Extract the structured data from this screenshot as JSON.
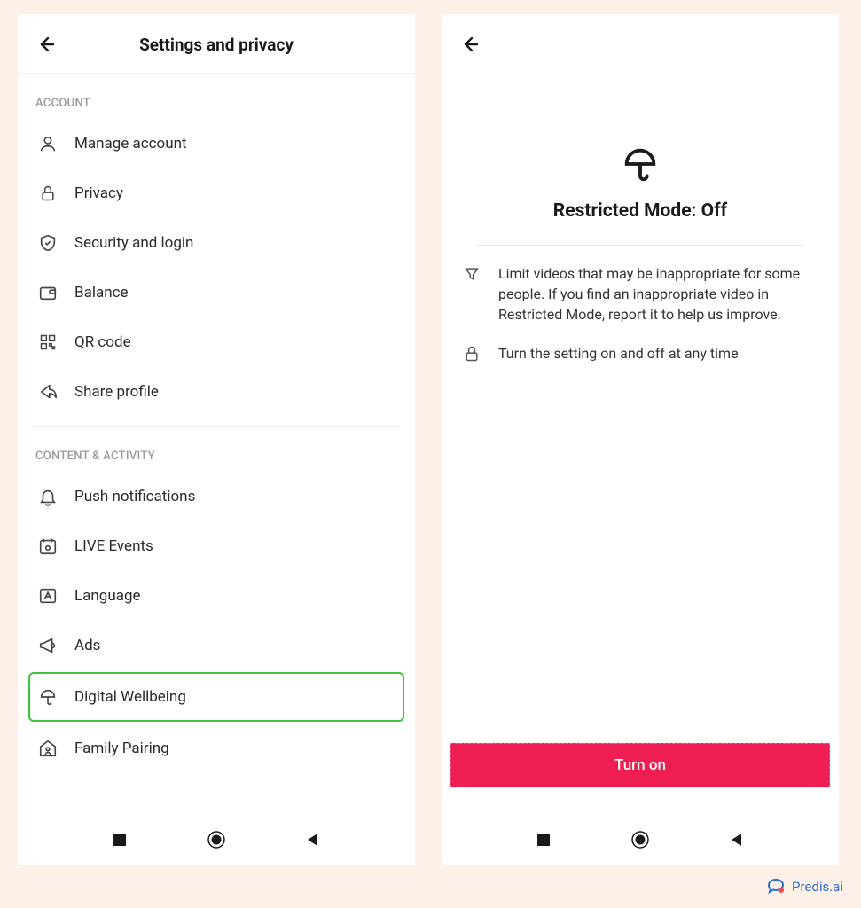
{
  "left": {
    "header_title": "Settings and privacy",
    "sections": [
      {
        "label": "ACCOUNT",
        "items": [
          {
            "icon": "person",
            "label": "Manage account"
          },
          {
            "icon": "lock",
            "label": "Privacy"
          },
          {
            "icon": "shield",
            "label": "Security and login"
          },
          {
            "icon": "wallet",
            "label": "Balance"
          },
          {
            "icon": "qr",
            "label": "QR code"
          },
          {
            "icon": "share",
            "label": "Share profile"
          }
        ]
      },
      {
        "label": "CONTENT & ACTIVITY",
        "items": [
          {
            "icon": "bell",
            "label": "Push notifications"
          },
          {
            "icon": "calendar",
            "label": "LIVE Events"
          },
          {
            "icon": "language",
            "label": "Language"
          },
          {
            "icon": "megaphone",
            "label": "Ads"
          },
          {
            "icon": "umbrella",
            "label": "Digital Wellbeing",
            "highlighted": true
          },
          {
            "icon": "family",
            "label": "Family Pairing"
          }
        ]
      }
    ]
  },
  "right": {
    "title": "Restricted Mode: Off",
    "info": [
      {
        "icon": "filter",
        "text": "Limit videos that may be inappropriate for some people. If you find an inappropriate video in Restricted Mode, report it to help us improve."
      },
      {
        "icon": "lock",
        "text": "Turn the setting on and off at any time"
      }
    ],
    "button": "Turn on"
  },
  "brand": "Predis.ai"
}
